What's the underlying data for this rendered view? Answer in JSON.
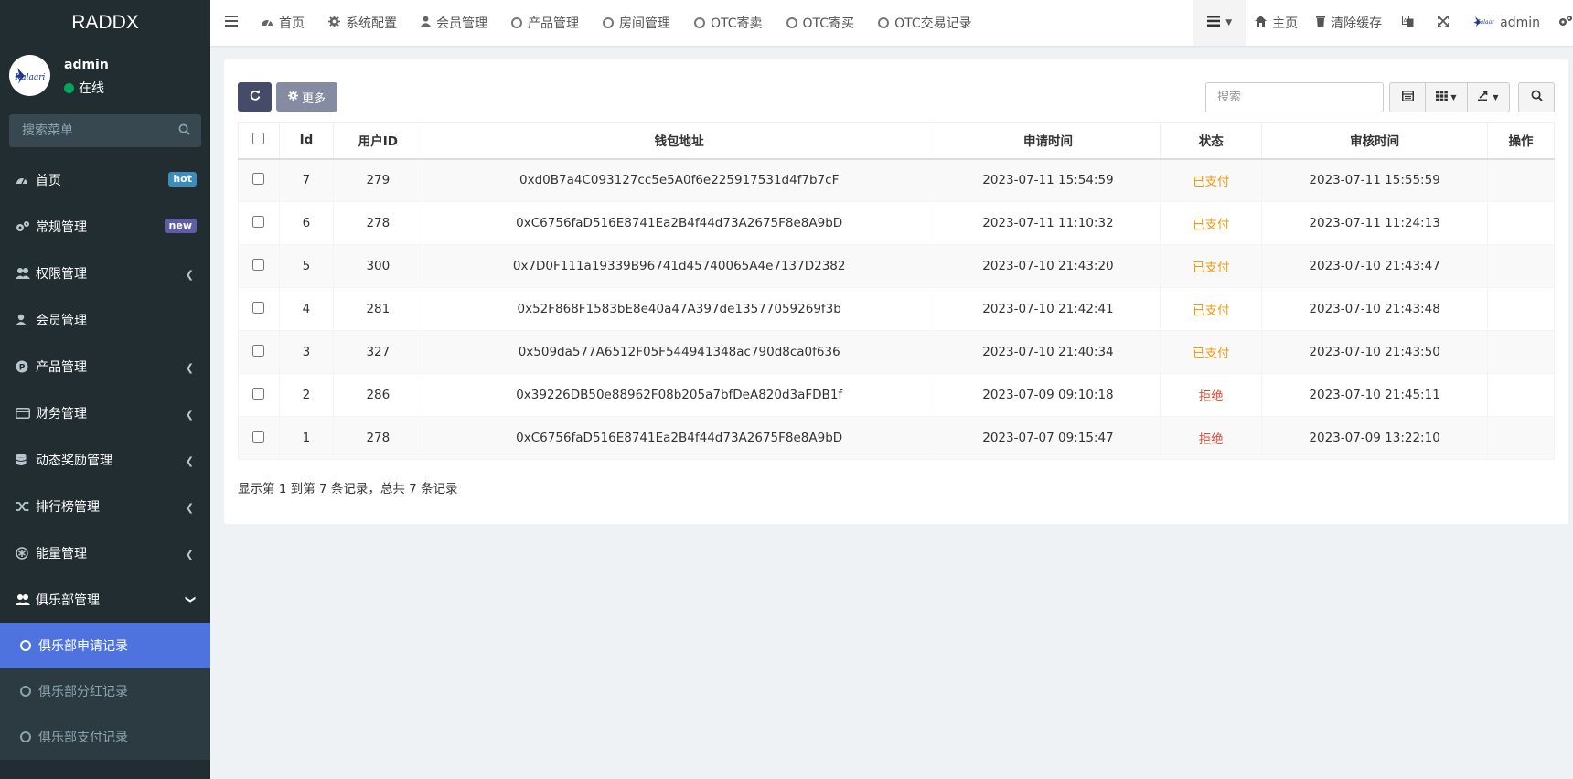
{
  "brand": "RADDX",
  "user": {
    "name": "admin",
    "status": "在线",
    "logo_text": "Kalaari"
  },
  "sidebar": {
    "search_placeholder": "搜索菜单",
    "items": [
      {
        "label": "首页",
        "badge": "hot"
      },
      {
        "label": "常规管理",
        "badge": "new"
      },
      {
        "label": "权限管理"
      },
      {
        "label": "会员管理"
      },
      {
        "label": "产品管理"
      },
      {
        "label": "财务管理"
      },
      {
        "label": "动态奖励管理"
      },
      {
        "label": "排行榜管理"
      },
      {
        "label": "能量管理"
      },
      {
        "label": "俱乐部管理"
      }
    ],
    "subitems": [
      {
        "label": "俱乐部申请记录",
        "active": true
      },
      {
        "label": "俱乐部分红记录"
      },
      {
        "label": "俱乐部支付记录"
      }
    ]
  },
  "topnav": {
    "tabs": [
      "首页",
      "系统配置",
      "会员管理",
      "产品管理",
      "房间管理",
      "OTC寄卖",
      "OTC寄买",
      "OTC交易记录"
    ],
    "home": "主页",
    "clear_cache": "清除缓存",
    "user": "admin"
  },
  "toolbar": {
    "more_label": "更多",
    "search_placeholder": "搜索"
  },
  "table": {
    "headers": [
      "Id",
      "用户ID",
      "钱包地址",
      "申请时间",
      "状态",
      "审核时间",
      "操作"
    ],
    "rows": [
      [
        "7",
        "279",
        "0xd0B7a4C093127cc5e5A0f6e225917531d4f7b7cF",
        "2023-07-11 15:54:59",
        "已支付",
        "2023-07-11 15:55:59"
      ],
      [
        "6",
        "278",
        "0xC6756faD516E8741Ea2B4f44d73A2675F8e8A9bD",
        "2023-07-11 11:10:32",
        "已支付",
        "2023-07-11 11:24:13"
      ],
      [
        "5",
        "300",
        "0x7D0F111a19339B96741d45740065A4e7137D2382",
        "2023-07-10 21:43:20",
        "已支付",
        "2023-07-10 21:43:47"
      ],
      [
        "4",
        "281",
        "0x52F868F1583bE8e40a47A397de13577059269f3b",
        "2023-07-10 21:42:41",
        "已支付",
        "2023-07-10 21:43:48"
      ],
      [
        "3",
        "327",
        "0x509da577A6512F05F544941348ac790d8ca0f636",
        "2023-07-10 21:40:34",
        "已支付",
        "2023-07-10 21:43:50"
      ],
      [
        "2",
        "286",
        "0x39226DB50e88962F08b205a7bfDeA820d3aFDB1f",
        "2023-07-09 09:10:18",
        "拒绝",
        "2023-07-10 21:45:11"
      ],
      [
        "1",
        "278",
        "0xC6756faD516E8741Ea2B4f44d73A2675F8e8A9bD",
        "2023-07-07 09:15:47",
        "拒绝",
        "2023-07-09 13:22:10"
      ]
    ]
  },
  "pager_info": "显示第 1 到第 7 条记录，总共 7 条记录",
  "colors": {
    "sidebar_bg": "#222d32",
    "active": "#4e73df",
    "paid": "#f39c12",
    "rejected": "#dd4b39"
  }
}
